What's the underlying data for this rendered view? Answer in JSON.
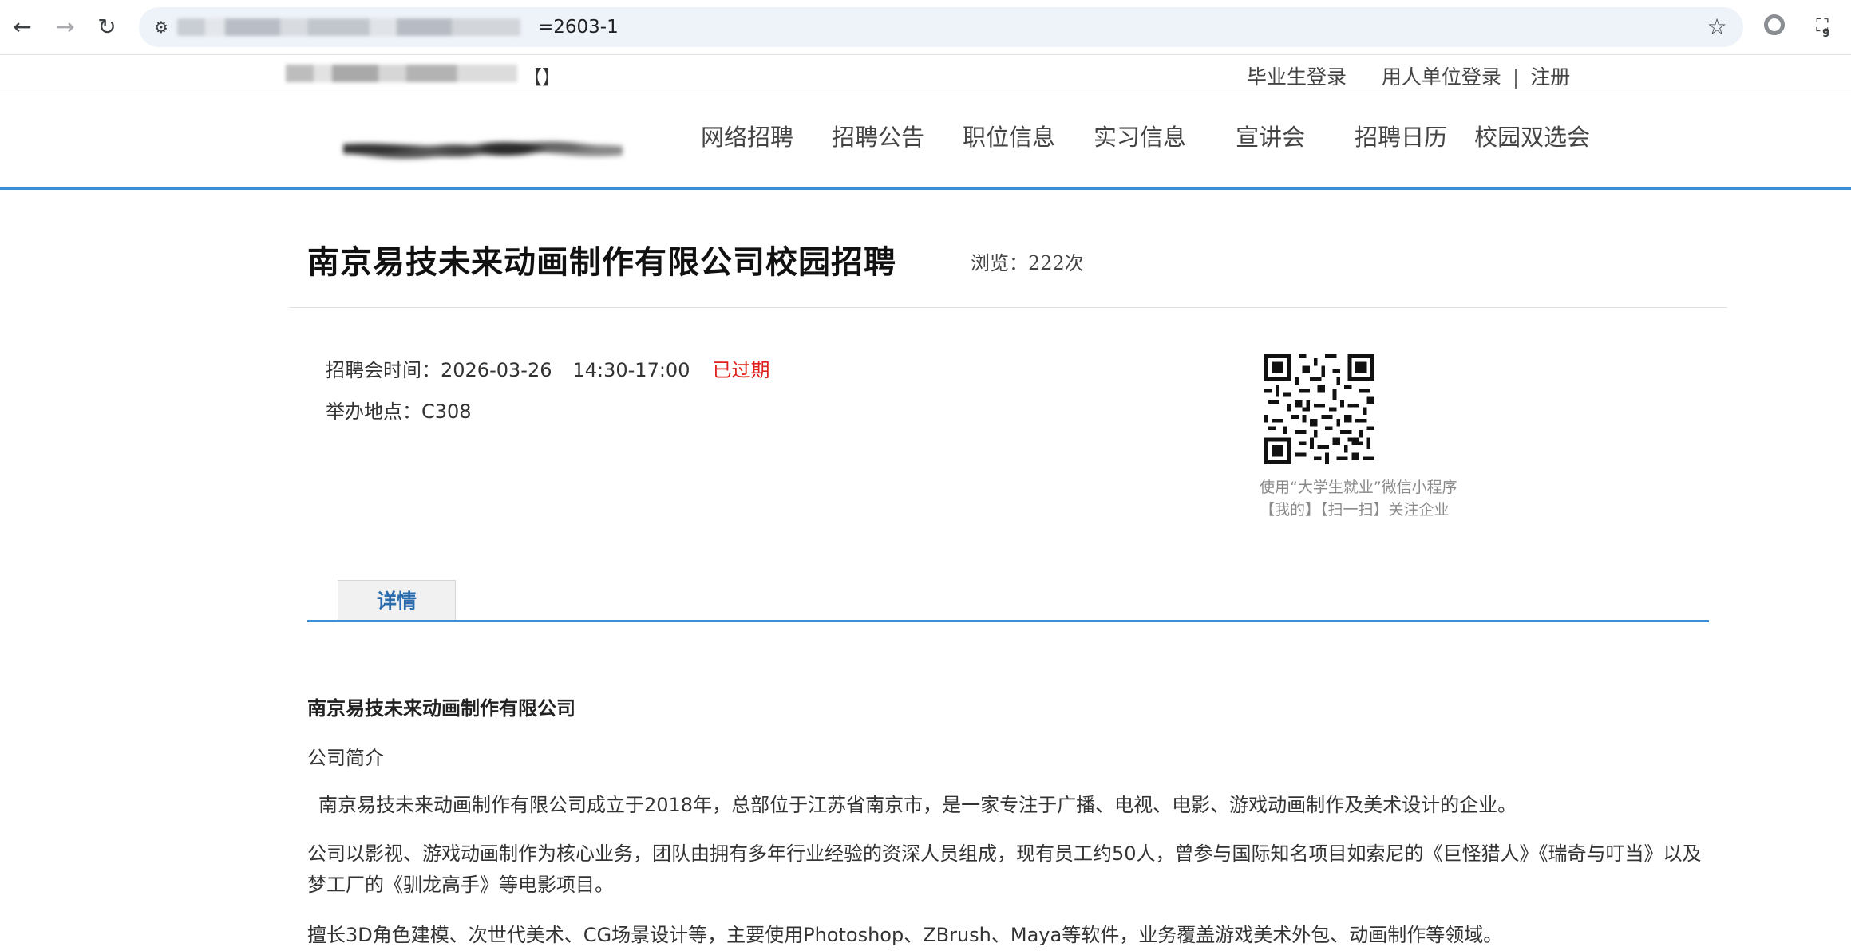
{
  "browser": {
    "url_visible": "=2603-1"
  },
  "topbar": {
    "site_name_suffix": "【】",
    "graduate_login": "毕业生登录",
    "employer_login": "用人单位登录",
    "separator": "|",
    "register": "注册"
  },
  "nav": {
    "items": [
      "网络招聘",
      "招聘公告",
      "职位信息",
      "实习信息",
      "宣讲会",
      "招聘日历",
      "校园双选会"
    ]
  },
  "page": {
    "title": "南京易技未来动画制作有限公司校园招聘",
    "views": "浏览：222次",
    "fair_time_label": "招聘会时间：",
    "fair_date": "2026-03-26",
    "fair_time": "14:30-17:00",
    "status": "已过期",
    "venue_label": "举办地点：",
    "venue": "C308",
    "qr_caption_line1": "使用“大学生就业”微信小程序",
    "qr_caption_line2": "【我的】【扫一扫】关注企业",
    "tab_details": "详情"
  },
  "details": {
    "company_name": "南京易技未来动画制作有限公司",
    "intro_label": "公司简介",
    "para1": "南京易技未来动画制作有限公司成立于2018年，总部位于江苏省南京市，是一家专注于广播、电视、电影、游戏动画制作及美术设计的企业。",
    "para2": "公司以影视、游戏动画制作为核心业务，团队由拥有多年行业经验的资深人员组成，现有员工约50人，曾参与国际知名项目如索尼的《巨怪猎人》《瑞奇与叮当》以及梦工厂的《驯龙高手》等电影项目。",
    "para3": "擅长3D角色建模、次世代美术、CG场景设计等，主要使用Photoshop、ZBrush、Maya等软件，业务覆盖游戏美术外包、动画制作等领域。"
  }
}
